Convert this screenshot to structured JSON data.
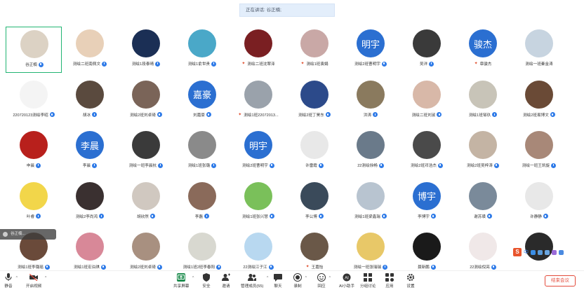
{
  "speaking_banner": "正在讲话: 谷正楠;",
  "participants": [
    {
      "name": "谷正楠",
      "avatar_text": "",
      "avatar_color": "#dcd2c4",
      "active": true,
      "host": false,
      "badge": "mic"
    },
    {
      "name": "测绘二班南佩文",
      "avatar_text": "",
      "avatar_color": "#e8d0b8",
      "host": false,
      "badge": "mic"
    },
    {
      "name": "测绘1段泰晴",
      "avatar_text": "",
      "avatar_color": "#1b2f55",
      "host": false,
      "badge": "mic"
    },
    {
      "name": "测绘1俞世贵",
      "avatar_text": "",
      "avatar_color": "#4aa8c8",
      "host": false,
      "badge": "mic"
    },
    {
      "name": "测绘二班沈翠泽",
      "avatar_text": "",
      "avatar_color": "#7a1f22",
      "host": true,
      "badge": ""
    },
    {
      "name": "测绘1班袁娟",
      "avatar_text": "",
      "avatar_color": "#c9a8a6",
      "host": true,
      "badge": ""
    },
    {
      "name": "测绘2班曹明宇",
      "avatar_text": "明宇",
      "avatar_color": "#2b6fd1",
      "host": false,
      "badge": "mic"
    },
    {
      "name": "吴洋",
      "avatar_text": "",
      "avatar_color": "#3a3a3a",
      "host": false,
      "badge": "mic"
    },
    {
      "name": "章骏杰",
      "avatar_text": "骏杰",
      "avatar_color": "#2b6fd1",
      "host": true,
      "badge": ""
    },
    {
      "name": "测绘一班秦金涛",
      "avatar_text": "",
      "avatar_color": "#c7d4e0",
      "host": false,
      "badge": ""
    },
    {
      "name": "2207201​23测绘李昭",
      "avatar_text": "",
      "avatar_color": "#f4f4f4",
      "host": false,
      "badge": "mic"
    },
    {
      "name": "胡冰",
      "avatar_text": "",
      "avatar_color": "#5a4a3e",
      "host": false,
      "badge": "mic"
    },
    {
      "name": "测绘2班刘卓琦",
      "avatar_text": "",
      "avatar_color": "#7a6458",
      "host": false,
      "badge": "mic"
    },
    {
      "name": "刘嘉豪",
      "avatar_text": "嘉豪",
      "avatar_color": "#2b6fd1",
      "host": false,
      "badge": "mic"
    },
    {
      "name": "测绘1班22072013...",
      "avatar_text": "",
      "avatar_color": "#9aa2ab",
      "host": true,
      "badge": ""
    },
    {
      "name": "测绘2班丁昊东",
      "avatar_text": "",
      "avatar_color": "#2c4a8a",
      "host": false,
      "badge": "mic"
    },
    {
      "name": "洪涛",
      "avatar_text": "",
      "avatar_color": "#8a7a5e",
      "host": false,
      "badge": "mic"
    },
    {
      "name": "测绘二班刘淑",
      "avatar_text": "",
      "avatar_color": "#d8b8a8",
      "host": false,
      "badge": "mic"
    },
    {
      "name": "测绘1班邹玖",
      "avatar_text": "",
      "avatar_color": "#c8c4b8",
      "host": false,
      "badge": "mic"
    },
    {
      "name": "测绘2班易博文",
      "avatar_text": "",
      "avatar_color": "#6a4a36",
      "host": false,
      "badge": "mic"
    },
    {
      "name": "申晨",
      "avatar_text": "",
      "avatar_color": "#b8201c",
      "host": false,
      "badge": "mic"
    },
    {
      "name": "李晨",
      "avatar_text": "李晨",
      "avatar_color": "#2b6fd1",
      "host": false,
      "badge": "mic"
    },
    {
      "name": "测绘一班李晨杭",
      "avatar_text": "",
      "avatar_color": "#3a3a3a",
      "host": false,
      "badge": "mic"
    },
    {
      "name": "测绘1班张璐",
      "avatar_text": "",
      "avatar_color": "#8a8a8a",
      "host": false,
      "badge": "mic"
    },
    {
      "name": "测绘2班曹明宇",
      "avatar_text": "明宇",
      "avatar_color": "#2b6fd1",
      "host": false,
      "badge": "mic"
    },
    {
      "name": "许雷霞",
      "avatar_text": "",
      "avatar_color": "#e8e8e8",
      "host": false,
      "badge": "mic"
    },
    {
      "name": "22测绘徐畅",
      "avatar_text": "",
      "avatar_color": "#6a7a8a",
      "host": false,
      "badge": "mic"
    },
    {
      "name": "测绘2班邓浩杰",
      "avatar_text": "",
      "avatar_color": "#4a4a4a",
      "host": false,
      "badge": "mic"
    },
    {
      "name": "测绘2班吴梓涛",
      "avatar_text": "",
      "avatar_color": "#c4b4a4",
      "host": false,
      "badge": "mic"
    },
    {
      "name": "测绘一班王凯旋",
      "avatar_text": "",
      "avatar_color": "#a88878",
      "host": false,
      "badge": "mic"
    },
    {
      "name": "叶睿",
      "avatar_text": "",
      "avatar_color": "#f2d64a",
      "host": false,
      "badge": "mic"
    },
    {
      "name": "测绘2李尚鸿",
      "avatar_text": "",
      "avatar_color": "#3a3030",
      "host": false,
      "badge": "mic"
    },
    {
      "name": "胡欣然",
      "avatar_text": "",
      "avatar_color": "#d0c8c0",
      "host": false,
      "badge": "mic"
    },
    {
      "name": "李磊",
      "avatar_text": "",
      "avatar_color": "#8a6a5a",
      "host": false,
      "badge": "mic"
    },
    {
      "name": "测绘1班张兴慧",
      "avatar_text": "",
      "avatar_color": "#7ac05a",
      "host": false,
      "badge": "mic"
    },
    {
      "name": "李公博",
      "avatar_text": "",
      "avatar_color": "#3a4a5a",
      "host": false,
      "badge": "mic"
    },
    {
      "name": "测绘1班梁鑫瑞",
      "avatar_text": "",
      "avatar_color": "#b8c4d0",
      "host": false,
      "badge": "mic"
    },
    {
      "name": "李博宇",
      "avatar_text": "博宇",
      "avatar_color": "#2b6fd1",
      "host": false,
      "badge": "mic"
    },
    {
      "name": "谢苏璜",
      "avatar_text": "",
      "avatar_color": "#7a8a9a",
      "host": false,
      "badge": "mic"
    },
    {
      "name": "许静静",
      "avatar_text": "",
      "avatar_color": "#e8e8e8",
      "host": false,
      "badge": "mic"
    },
    {
      "name": "测绘1班李璐瑶",
      "avatar_text": "",
      "avatar_color": "#6a4a3a",
      "host": false,
      "badge": "mic"
    },
    {
      "name": "测绘1班宏泊琪",
      "avatar_text": "",
      "avatar_color": "#d88898",
      "host": false,
      "badge": "mic"
    },
    {
      "name": "测绘2班刘卓琦",
      "avatar_text": "",
      "avatar_color": "#a89080",
      "host": false,
      "badge": "mic"
    },
    {
      "name": "测绘1班2班李春阳",
      "avatar_text": "",
      "avatar_color": "#d8d8d0",
      "host": false,
      "badge": "mic"
    },
    {
      "name": "22测绘江子江",
      "avatar_text": "",
      "avatar_color": "#b8d8f0",
      "host": false,
      "badge": "mic"
    },
    {
      "name": "王嘉怡",
      "avatar_text": "",
      "avatar_color": "#6a5848",
      "host": true,
      "badge": ""
    },
    {
      "name": "测绘一班张瑞瑞",
      "avatar_text": "",
      "avatar_color": "#e8c868",
      "host": false,
      "badge": "mic"
    },
    {
      "name": "聂新鹏",
      "avatar_text": "",
      "avatar_color": "#1a1a1a",
      "host": false,
      "badge": "mic"
    },
    {
      "name": "22测绘倪亮",
      "avatar_text": "",
      "avatar_color": "#f0e8e8",
      "host": false,
      "badge": "mic"
    },
    {
      "name": "",
      "avatar_text": "",
      "avatar_color": "#2a2a2a",
      "host": false,
      "badge": ""
    }
  ],
  "side_toast": "谷正楠...",
  "toolbar": {
    "mute": "静音",
    "video": "开启视频",
    "share": "共享屏幕",
    "security": "安全",
    "invite": "邀请",
    "members": "管理成员(55)",
    "chat": "聊天",
    "record": "录制",
    "reactions": "回应",
    "ai": "AI小助手",
    "breakout": "分组讨论",
    "apps": "应用",
    "settings": "设置",
    "end": "结束会议"
  },
  "ime": {
    "logo": "S",
    "lang": "中"
  },
  "colors": {
    "accent": "#2b6fd1",
    "active_border": "#22b573",
    "end": "#e34a3a"
  }
}
